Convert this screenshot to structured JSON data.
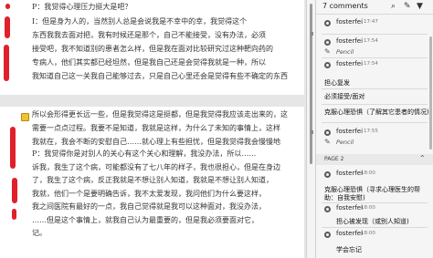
{
  "document": {
    "page1_lines": [
      "P：我觉得心理压力挺大是吧？",
      "I：但是身为人的，当然别人总是会说我是不幸中的幸，我觉得这个",
      "东西我我去面对把，我有时候还是那个，自己不能接受，没有办法，必须",
      "接受吧，我不知道别的患者怎么样，但是我在面对比较研究过这种靶向药的",
      "专病人，他们其实都已经坦然，但是我自己还是会觉得我就是一种，所以",
      "我知道自己这一关我自己能够过去，只是自己心里还会是觉得有些不确定的东西"
    ],
    "page2_lines": [
      "所以会形得更长远一些，但是我觉得这是挺都，但是我觉得我应该走出来的，这",
      "需要一点点过程。我要不是知道，我就是这样，为什么了未知的事情上，这样",
      "我就在，我会不断的安慰自己……就心理上有些担忧，但是我觉得我会慢慢地",
      "P：我觉得你是对别人的关心有这个关心和理解，我没办法，所以……",
      "诉我，我生了这个病，可能都没有了七八年的样子，我也很担心，但是在身边",
      "了，我生了这个病，反正我就是不想让别人知道，我就是不想让别人知道，",
      "我就，他们一个是要明确告诉，我不太爱发现，我问他们为什么要这样，",
      "我之间医院有最好的一点，我自己觉得就是我可以这种面对，我没办法，",
      "……但是这个事情上，就我自己认为最重要的，但是我必须要面对它，",
      "记。"
    ]
  },
  "panel": {
    "title": "7 comments",
    "page2_label": "PAGE 2"
  },
  "comments": [
    {
      "author": "fosterfei",
      "time": "17:47"
    },
    {
      "author": "fosterfei",
      "time": "17:54",
      "tool": "Pencil"
    },
    {
      "author": "fosterfei",
      "time": "17:54",
      "text": "担心复发"
    },
    {
      "text": "必须接受/面对"
    },
    {
      "text": "克服心理恐惧（了解其它患者的情况)"
    },
    {
      "author": "fosterfei",
      "time": "17:55",
      "tool": "Pencil"
    },
    {
      "author": "fosterfei",
      "time": "18:00",
      "text": "克服心理恐惧（寻求心理医生的帮助：自我安慰)"
    },
    {
      "author": "fosterfei",
      "time": "18:00",
      "text": "担心被发现（或别人知道)"
    },
    {
      "author": "fosterfei",
      "time": "18:00",
      "text": "学会忘记"
    }
  ],
  "colors": {
    "highlight": "#e0202a",
    "pin": "#f2c230"
  },
  "icons": [
    "search-icon",
    "edit-icon",
    "filter-icon",
    "comment-pin-icon",
    "pencil-icon",
    "chevron-up-icon"
  ]
}
